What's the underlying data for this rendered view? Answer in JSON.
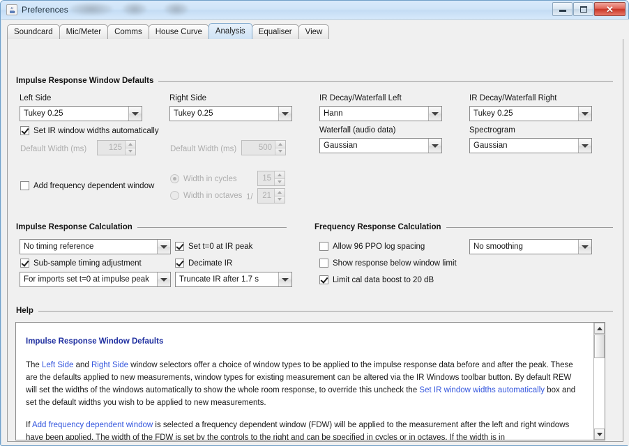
{
  "window": {
    "title": "Preferences",
    "icon": "java-coffee-cup-icon",
    "minimize_label": "Minimize",
    "maximize_label": "Maximize",
    "close_label": "Close",
    "close_glyph": "✕"
  },
  "tabs": [
    {
      "label": "Soundcard",
      "active": false
    },
    {
      "label": "Mic/Meter",
      "active": false
    },
    {
      "label": "Comms",
      "active": false
    },
    {
      "label": "House Curve",
      "active": false
    },
    {
      "label": "Analysis",
      "active": true
    },
    {
      "label": "Equaliser",
      "active": false
    },
    {
      "label": "View",
      "active": false
    }
  ],
  "ir_window_defaults": {
    "section_title": "Impulse Response Window Defaults",
    "left_side_label": "Left Side",
    "left_side_value": "Tukey 0.25",
    "right_side_label": "Right Side",
    "right_side_value": "Tukey 0.25",
    "ir_decay_left_label": "IR Decay/Waterfall Left",
    "ir_decay_left_value": "Hann",
    "ir_decay_right_label": "IR Decay/Waterfall Right",
    "ir_decay_right_value": "Tukey 0.25",
    "waterfall_label": "Waterfall (audio data)",
    "waterfall_value": "Gaussian",
    "spectrogram_label": "Spectrogram",
    "spectrogram_value": "Gaussian",
    "auto_widths_label": "Set IR window widths automatically",
    "auto_widths_checked": true,
    "default_width_left_label": "Default Width (ms)",
    "default_width_left_value": "125",
    "default_width_right_label": "Default Width (ms)",
    "default_width_right_value": "500",
    "add_fdw_label": "Add frequency dependent window",
    "add_fdw_checked": false,
    "width_cycles_label": "Width in cycles",
    "width_cycles_selected": true,
    "width_cycles_value": "15",
    "width_octaves_label": "Width in octaves",
    "width_octaves_prefix": "1/",
    "width_octaves_selected": false,
    "width_octaves_value": "21"
  },
  "ir_calculation": {
    "section_title": "Impulse Response Calculation",
    "timing_reference_value": "No timing reference",
    "set_t0_peak_label": "Set t=0 at IR peak",
    "set_t0_peak_checked": true,
    "subsample_label": "Sub-sample timing adjustment",
    "subsample_checked": true,
    "decimate_label": "Decimate IR",
    "decimate_checked": true,
    "imports_value": "For imports set t=0 at impulse peak",
    "truncate_value": "Truncate IR after 1.7 s"
  },
  "fr_calculation": {
    "section_title": "Frequency Response Calculation",
    "ppo_label": "Allow 96 PPO log spacing",
    "ppo_checked": false,
    "below_limit_label": "Show response below window limit",
    "below_limit_checked": false,
    "cal_boost_label": "Limit cal data boost to 20 dB",
    "cal_boost_checked": true,
    "smoothing_value": "No  smoothing"
  },
  "help": {
    "section_title": "Help",
    "heading": "Impulse Response Window Defaults",
    "p1_a": "The ",
    "p1_link1": "Left Side",
    "p1_b": " and ",
    "p1_link2": "Right Side",
    "p1_c": " window selectors offer a choice of window types to be applied to the impulse response data before and after the peak. These are the defaults applied to new measurements, window types for existing measurement can be altered via the IR Windows toolbar button. By default REW will set the widths of the windows automatically to show the whole room response, to override this uncheck the ",
    "p1_link3": "Set IR window widths automatically",
    "p1_d": " box and set the default widths you wish to be applied to new measurements.",
    "p2_a": "If ",
    "p2_link1": "Add frequency dependent window",
    "p2_b": " is selected a frequency dependent window (FDW) will be applied to the measurement after the left and right windows have been applied. The width of the FDW is set by the controls to the right and can be specified in cycles or in octaves. If the width is in"
  }
}
